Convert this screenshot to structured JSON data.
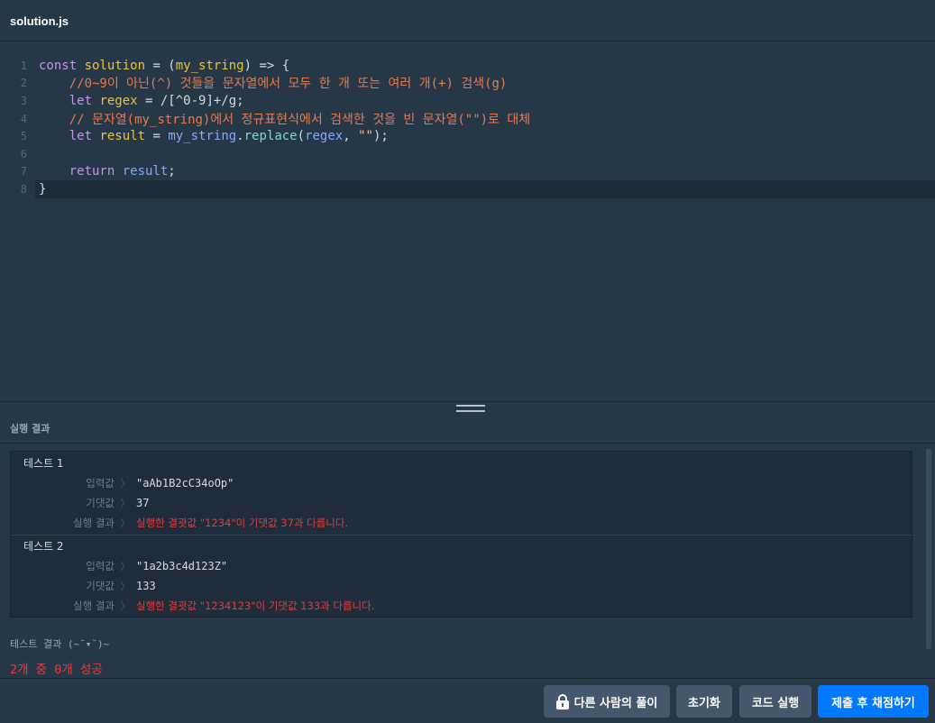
{
  "tab": {
    "filename": "solution.js"
  },
  "editor": {
    "lines": [
      {
        "num": "1",
        "tokens": [
          {
            "t": "const ",
            "c": "kw"
          },
          {
            "t": "solution",
            "c": "fn"
          },
          {
            "t": " = (",
            "c": "op"
          },
          {
            "t": "my_string",
            "c": "var"
          },
          {
            "t": ") => {",
            "c": "op"
          }
        ]
      },
      {
        "num": "2",
        "tokens": [
          {
            "t": "    //0~9이 아닌(^) 것들을 문자열에서 모두 한 개 또는 여러 개(+) 검색(g)",
            "c": "cm"
          }
        ]
      },
      {
        "num": "3",
        "tokens": [
          {
            "t": "    let ",
            "c": "kw"
          },
          {
            "t": "regex",
            "c": "var"
          },
          {
            "t": " = /[^0-9]+/g;",
            "c": "op"
          }
        ]
      },
      {
        "num": "4",
        "tokens": [
          {
            "t": "    // 문자열(my_string)에서 정규표현식에서 검색한 것을 빈 문자열(\"\")로 대체",
            "c": "cm"
          }
        ]
      },
      {
        "num": "5",
        "tokens": [
          {
            "t": "    let ",
            "c": "kw"
          },
          {
            "t": "result",
            "c": "var"
          },
          {
            "t": " = ",
            "c": "op"
          },
          {
            "t": "my_string",
            "c": "ph"
          },
          {
            "t": ".",
            "c": "op"
          },
          {
            "t": "replace",
            "c": "method"
          },
          {
            "t": "(",
            "c": "op"
          },
          {
            "t": "regex",
            "c": "ph"
          },
          {
            "t": ", ",
            "c": "op"
          },
          {
            "t": "\"\"",
            "c": "str"
          },
          {
            "t": ");",
            "c": "op"
          }
        ]
      },
      {
        "num": "6",
        "tokens": []
      },
      {
        "num": "7",
        "tokens": [
          {
            "t": "    return ",
            "c": "kw"
          },
          {
            "t": "result",
            "c": "ph"
          },
          {
            "t": ";",
            "c": "op"
          }
        ]
      },
      {
        "num": "8",
        "tokens": [
          {
            "t": "}",
            "c": "op"
          }
        ],
        "active": true
      }
    ]
  },
  "result_panel": {
    "title": "실행 결과",
    "tests": [
      {
        "title": "테스트 1",
        "rows": [
          {
            "label": "입력값",
            "value": "\"aAb1B2cC34oOp\"",
            "fail": false
          },
          {
            "label": "기댓값",
            "value": "37",
            "fail": false
          },
          {
            "label": "실행 결과",
            "value": "실행한 결괏값 \"1234\"이 기댓값 37과 다릅니다.",
            "fail": true
          }
        ]
      },
      {
        "title": "테스트 2",
        "rows": [
          {
            "label": "입력값",
            "value": "\"1a2b3c4d123Z\"",
            "fail": false
          },
          {
            "label": "기댓값",
            "value": "133",
            "fail": false
          },
          {
            "label": "실행 결과",
            "value": "실행한 결괏값 \"1234123\"이 기댓값 133과 다릅니다.",
            "fail": true
          }
        ]
      }
    ],
    "row_separator": "〉",
    "summary_title": "테스트 결과 (~˘▾˘)~",
    "summary_result": "2개 중 0개 성공"
  },
  "footer": {
    "others_solution_label": "다른 사람의 풀이",
    "reset_label": "초기화",
    "run_label": "코드 실행",
    "submit_label": "제출 후 채점하기"
  },
  "colors": {
    "fail": "#e03e3e",
    "primary": "#0078ff",
    "background": "#263747"
  }
}
